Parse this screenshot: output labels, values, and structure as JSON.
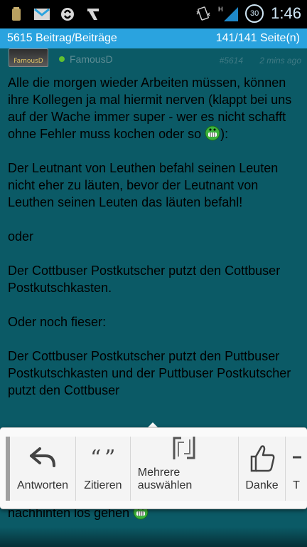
{
  "statusbar": {
    "time": "1:46",
    "badge": "30",
    "network": "H",
    "icons": [
      "storage-icon",
      "gmail-icon",
      "sync-icon",
      "app-icon",
      "vibrate-icon",
      "signal-icon",
      "badge-icon"
    ]
  },
  "titlebar": {
    "left": "5615 Beitrag/Beiträge",
    "right": "141/141 Seite(n)"
  },
  "post": {
    "avatar_label": "FamousD",
    "username": "FamousD",
    "number": "#5614",
    "time": "2 mins ago",
    "paragraphs": [
      "Alle die morgen wieder Arbeiten müssen, können ihre Kollegen ja mal hiermit nerven (klappt bei uns auf der Wache immer super - wer es nicht schafft ohne Fehler muss kochen oder so",
      "):",
      "Der Leutnant von Leuthen befahl seinen Leuten nicht eher zu läuten, bevor der Leutnant von Leuthen seinen Leuten das läuten befahl!",
      "oder",
      "Der Cottbuser Postkutscher putzt den Cottbuser Postkutschkasten.",
      "Oder noch fieser:",
      "Der Cottbuser Postkutscher putzt den Puttbuser Postkutschkasten und der Puttbuser Postkutscher putzt den Cottbuser",
      "nachhinten los gehen"
    ]
  },
  "actions": {
    "answer": "Antworten",
    "cite": "Zitieren",
    "multi": "Mehrere auswählen",
    "thanks": "Danke",
    "more": "T"
  },
  "colors": {
    "background": "#0b5a66",
    "titlebar": "#2aa3df",
    "online": "#60c030"
  }
}
